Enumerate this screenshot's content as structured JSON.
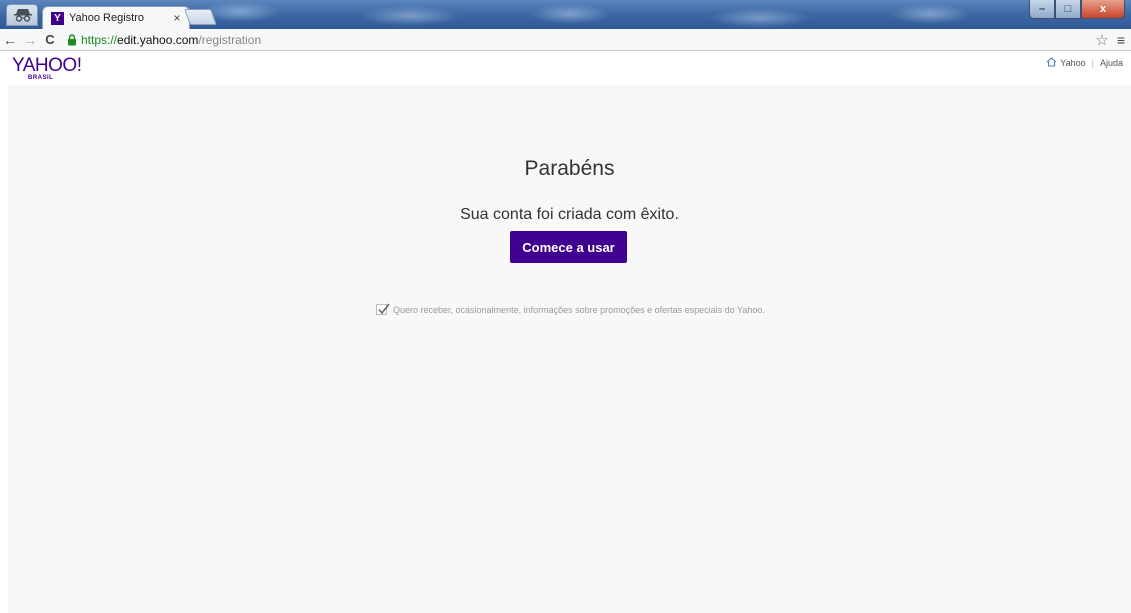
{
  "browser": {
    "tab_title": "Yahoo Registro",
    "tab_close": "×",
    "favicon_letter": "Y",
    "url": {
      "scheme": "https://",
      "host": "edit.yahoo.com",
      "path": "/registration"
    },
    "icons": {
      "back": "←",
      "forward": "→",
      "reload": "C",
      "star": "☆",
      "menu": "≡"
    },
    "window_controls": {
      "minimize": "–",
      "maximize": "□",
      "close": "x"
    }
  },
  "header": {
    "logo_main": "YAHOO!",
    "logo_sub": "BRASIL",
    "links": {
      "home": "Yahoo",
      "help": "Ajuda"
    },
    "separator": "|"
  },
  "main": {
    "title": "Parabéns",
    "message": "Sua conta foi criada com êxito.",
    "start_button": "Comece a usar",
    "optin": {
      "checked": true,
      "label": "Quero receber, ocasionalmente, informações sobre promoções e ofertas especiais do Yahoo."
    }
  },
  "colors": {
    "brand": "#400090",
    "background": "#f8f8f8",
    "secure_green": "#1c8a1c"
  }
}
